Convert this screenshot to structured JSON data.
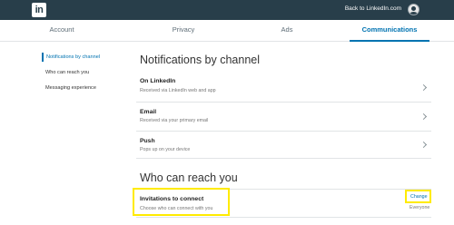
{
  "topbar": {
    "logo": "in",
    "back_link": "Back to LinkedIn.com"
  },
  "tabs": [
    {
      "label": "Account"
    },
    {
      "label": "Privacy"
    },
    {
      "label": "Ads"
    },
    {
      "label": "Communications"
    }
  ],
  "sidenav": [
    {
      "label": "Notifications by channel"
    },
    {
      "label": "Who can reach you"
    },
    {
      "label": "Messaging experience"
    }
  ],
  "notifications": {
    "title": "Notifications by channel",
    "rows": [
      {
        "title": "On LinkedIn",
        "sub": "Received via LinkedIn web and app"
      },
      {
        "title": "Email",
        "sub": "Received via your primary email"
      },
      {
        "title": "Push",
        "sub": "Pops up on your device"
      }
    ]
  },
  "reach": {
    "title": "Who can reach you",
    "invitations": {
      "title": "Invitations to connect",
      "sub": "Choose who can connect with you",
      "action": "Change",
      "value": "Everyone"
    }
  },
  "colors": {
    "topbar": "#283e4a",
    "accent": "#0073b1",
    "highlight": "#ffeb00"
  },
  "icons": {
    "avatar": "profile-avatar",
    "chevron": "chevron-right-icon"
  }
}
